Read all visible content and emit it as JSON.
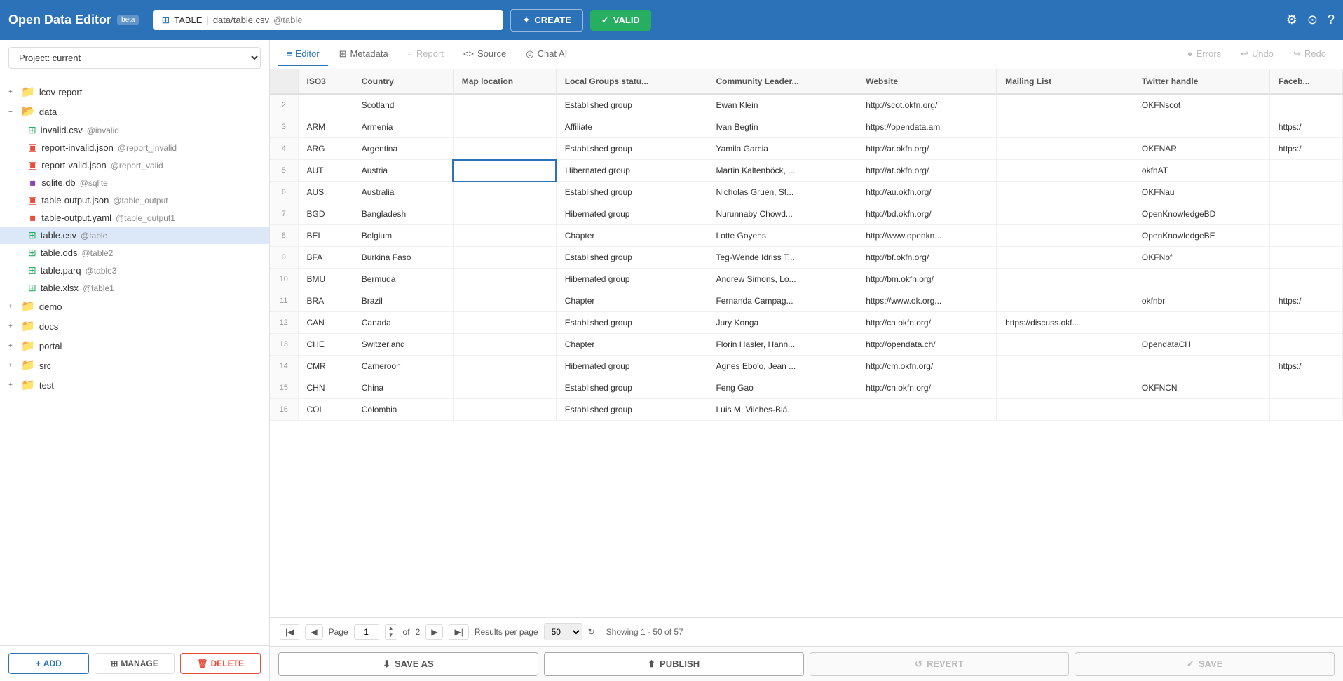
{
  "header": {
    "app_title": "Open Data Editor",
    "beta_label": "beta",
    "file_tab": {
      "icon": "⊞",
      "name": "TABLE",
      "path": "data/table.csv",
      "alias": "@table"
    },
    "create_label": "CREATE",
    "valid_label": "VALID"
  },
  "project": {
    "label": "Project:",
    "current": "current"
  },
  "sidebar": {
    "items": [
      {
        "id": "lcov-report",
        "label": "lcov-report",
        "level": 0,
        "type": "folder",
        "expand": "+",
        "expanded": false
      },
      {
        "id": "data",
        "label": "data",
        "level": 0,
        "type": "folder",
        "expand": "-",
        "expanded": true
      },
      {
        "id": "invalid-csv",
        "label": "invalid.csv",
        "alias": "@invalid",
        "level": 1,
        "type": "csv"
      },
      {
        "id": "report-invalid-json",
        "label": "report-invalid.json",
        "alias": "@report_invalid",
        "level": 1,
        "type": "json"
      },
      {
        "id": "report-valid-json",
        "label": "report-valid.json",
        "alias": "@report_valid",
        "level": 1,
        "type": "json"
      },
      {
        "id": "sqlite-db",
        "label": "sqlite.db",
        "alias": "@sqlite",
        "level": 1,
        "type": "db"
      },
      {
        "id": "table-output-json",
        "label": "table-output.json",
        "alias": "@table_output",
        "level": 1,
        "type": "json"
      },
      {
        "id": "table-output-yaml",
        "label": "table-output.yaml",
        "alias": "@table_output1",
        "level": 1,
        "type": "json"
      },
      {
        "id": "table-csv",
        "label": "table.csv",
        "alias": "@table",
        "level": 1,
        "type": "table",
        "active": true
      },
      {
        "id": "table-ods",
        "label": "table.ods",
        "alias": "@table2",
        "level": 1,
        "type": "table"
      },
      {
        "id": "table-parq",
        "label": "table.parq",
        "alias": "@table3",
        "level": 1,
        "type": "table"
      },
      {
        "id": "table-xlsx",
        "label": "table.xlsx",
        "alias": "@table1",
        "level": 1,
        "type": "table"
      },
      {
        "id": "demo",
        "label": "demo",
        "level": 0,
        "type": "folder",
        "expand": "+",
        "expanded": false
      },
      {
        "id": "docs",
        "label": "docs",
        "level": 0,
        "type": "folder",
        "expand": "+",
        "expanded": false
      },
      {
        "id": "portal",
        "label": "portal",
        "level": 0,
        "type": "folder",
        "expand": "+",
        "expanded": false
      },
      {
        "id": "src",
        "label": "src",
        "level": 0,
        "type": "folder",
        "expand": "+",
        "expanded": false
      },
      {
        "id": "test",
        "label": "test",
        "level": 0,
        "type": "folder",
        "expand": "+",
        "expanded": false
      }
    ],
    "add_label": "ADD",
    "manage_label": "MANAGE",
    "delete_label": "DELETE"
  },
  "tabs": [
    {
      "id": "editor",
      "label": "Editor",
      "icon": "≡",
      "active": true
    },
    {
      "id": "metadata",
      "label": "Metadata",
      "icon": "⊞",
      "active": false
    },
    {
      "id": "report",
      "label": "Report",
      "icon": "≈",
      "active": false,
      "disabled": true
    },
    {
      "id": "source",
      "label": "Source",
      "icon": "<>",
      "active": false
    },
    {
      "id": "chat-ai",
      "label": "Chat AI",
      "icon": "◎",
      "active": false
    },
    {
      "id": "errors",
      "label": "Errors",
      "icon": "●",
      "active": false,
      "disabled": true
    },
    {
      "id": "undo",
      "label": "Undo",
      "icon": "↩",
      "active": false
    },
    {
      "id": "redo",
      "label": "Redo",
      "icon": "↪",
      "active": false
    }
  ],
  "table": {
    "columns": [
      "ISO3",
      "Country",
      "Map location",
      "Local Groups statu...",
      "Community Leader...",
      "Website",
      "Mailing List",
      "Twitter handle",
      "Faceb..."
    ],
    "rows": [
      {
        "num": 2,
        "cells": [
          "",
          "Scotland",
          "",
          "Established group",
          "Ewan Klein",
          "http://scot.okfn.org/",
          "",
          "OKFNscot",
          ""
        ]
      },
      {
        "num": 3,
        "cells": [
          "ARM",
          "Armenia",
          "",
          "Affiliate",
          "Ivan Begtin",
          "https://opendata.am",
          "",
          "",
          "https:/"
        ]
      },
      {
        "num": 4,
        "cells": [
          "ARG",
          "Argentina",
          "",
          "Established group",
          "Yamila Garcia",
          "http://ar.okfn.org/",
          "",
          "OKFNAR",
          "https:/"
        ]
      },
      {
        "num": 5,
        "cells": [
          "AUT",
          "Austria",
          "",
          "Hibernated group",
          "Martin Kaltenböck, ...",
          "http://at.okfn.org/",
          "",
          "okfnAT",
          ""
        ]
      },
      {
        "num": 6,
        "cells": [
          "AUS",
          "Australia",
          "",
          "Established group",
          "Nicholas Gruen, St...",
          "http://au.okfn.org/",
          "",
          "OKFNau",
          ""
        ]
      },
      {
        "num": 7,
        "cells": [
          "BGD",
          "Bangladesh",
          "",
          "Hibernated group",
          "Nurunnaby Chowd...",
          "http://bd.okfn.org/",
          "",
          "OpenKnowledgeBD",
          ""
        ]
      },
      {
        "num": 8,
        "cells": [
          "BEL",
          "Belgium",
          "",
          "Chapter",
          "Lotte Goyens",
          "http://www.openkn...",
          "",
          "OpenKnowledgeBE",
          ""
        ]
      },
      {
        "num": 9,
        "cells": [
          "BFA",
          "Burkina Faso",
          "",
          "Established group",
          "Teg-Wende Idriss T...",
          "http://bf.okfn.org/",
          "",
          "OKFNbf",
          ""
        ]
      },
      {
        "num": 10,
        "cells": [
          "BMU",
          "Bermuda",
          "",
          "Hibernated group",
          "Andrew Simons, Lo...",
          "http://bm.okfn.org/",
          "",
          "",
          ""
        ]
      },
      {
        "num": 11,
        "cells": [
          "BRA",
          "Brazil",
          "",
          "Chapter",
          "Fernanda Campag...",
          "https://www.ok.org...",
          "",
          "okfnbr",
          "https:/"
        ]
      },
      {
        "num": 12,
        "cells": [
          "CAN",
          "Canada",
          "",
          "Established group",
          "Jury Konga",
          "http://ca.okfn.org/",
          "https://discuss.okf...",
          "",
          ""
        ]
      },
      {
        "num": 13,
        "cells": [
          "CHE",
          "Switzerland",
          "",
          "Chapter",
          "Florin Hasler, Hann...",
          "http://opendata.ch/",
          "",
          "OpendataCH",
          ""
        ]
      },
      {
        "num": 14,
        "cells": [
          "CMR",
          "Cameroon",
          "",
          "Hibernated group",
          "Agnes Ebo'o, Jean ...",
          "http://cm.okfn.org/",
          "",
          "",
          "https:/"
        ]
      },
      {
        "num": 15,
        "cells": [
          "CHN",
          "China",
          "",
          "Established group",
          "Feng Gao",
          "http://cn.okfn.org/",
          "",
          "OKFNCN",
          ""
        ]
      },
      {
        "num": 16,
        "cells": [
          "COL",
          "Colombia",
          "",
          "Established group",
          "Luis M. Vilches-Blá...",
          "",
          "",
          "",
          ""
        ]
      }
    ]
  },
  "pagination": {
    "page_label": "Page",
    "current_page": 1,
    "total_pages": 2,
    "of_label": "of",
    "results_label": "Results per page",
    "results_per_page": 50,
    "showing_text": "Showing 1 - 50 of 57"
  },
  "action_bar": {
    "save_as_label": "SAVE AS",
    "publish_label": "PUBLISH",
    "revert_label": "REVERT",
    "save_label": "SAVE"
  }
}
